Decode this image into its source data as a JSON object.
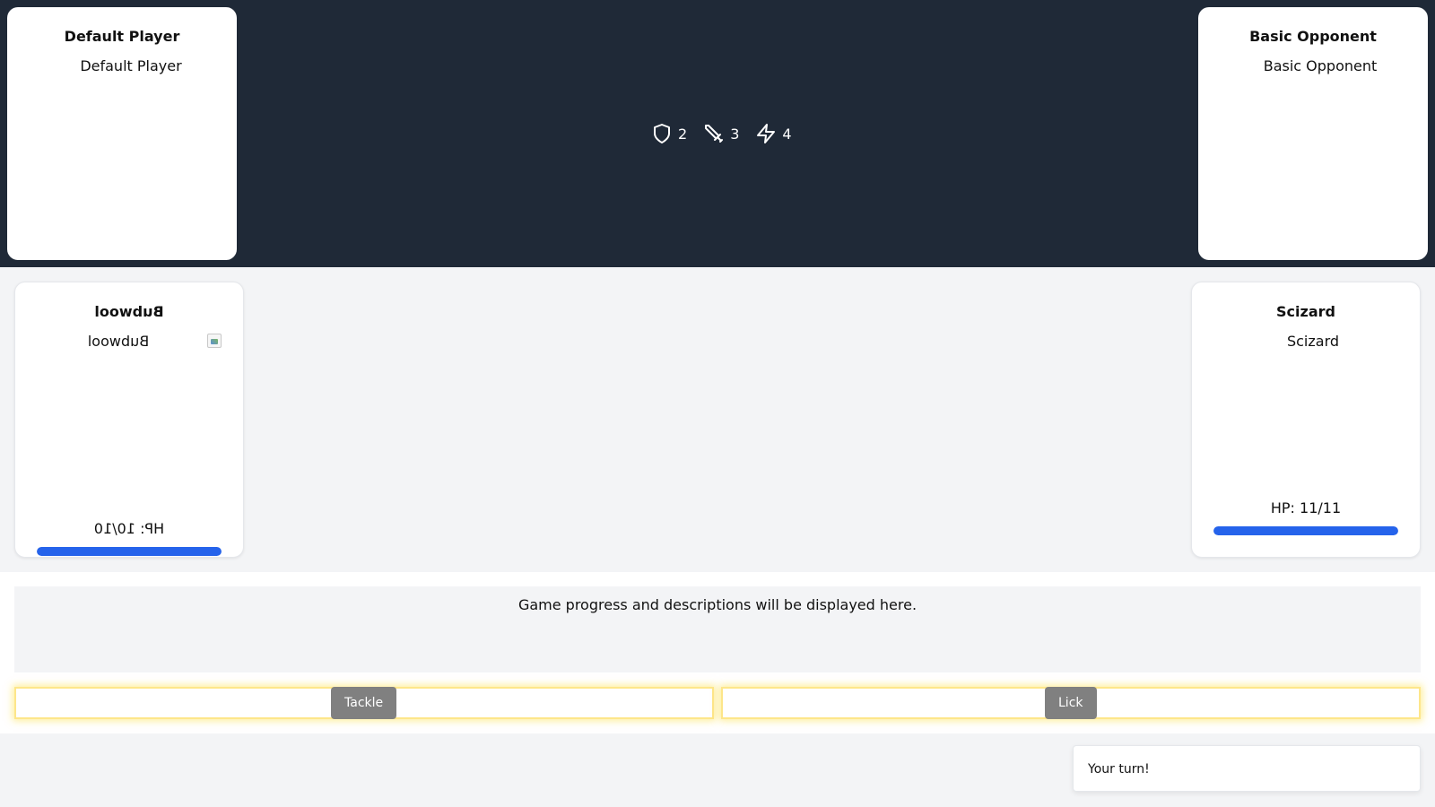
{
  "player": {
    "name": "Default Player",
    "image_alt": "Default Player"
  },
  "opponent": {
    "name": "Basic Opponent",
    "image_alt": "Basic Opponent"
  },
  "stats": [
    {
      "icon": "shield-icon",
      "value": "2"
    },
    {
      "icon": "sword-icon",
      "value": "3"
    },
    {
      "icon": "lightning-icon",
      "value": "4"
    }
  ],
  "player_monster": {
    "name": "Bubwool",
    "image_alt": "Bubwool",
    "hp_text": "HP: 10/10",
    "hp_fraction": 1.0
  },
  "opponent_monster": {
    "name": "Scizard",
    "image_alt": "Scizard",
    "hp_text": "HP: 11/11",
    "hp_fraction": 1.0
  },
  "log": {
    "text": "Game progress and descriptions will be displayed here."
  },
  "moves": [
    {
      "label": "Tackle"
    },
    {
      "label": "Lick"
    }
  ],
  "toast": {
    "text": "Your turn!"
  },
  "colors": {
    "header_bg": "#1f2937",
    "hp_bar": "#2563eb",
    "move_button": "#808080",
    "move_glow": "#fde047"
  }
}
